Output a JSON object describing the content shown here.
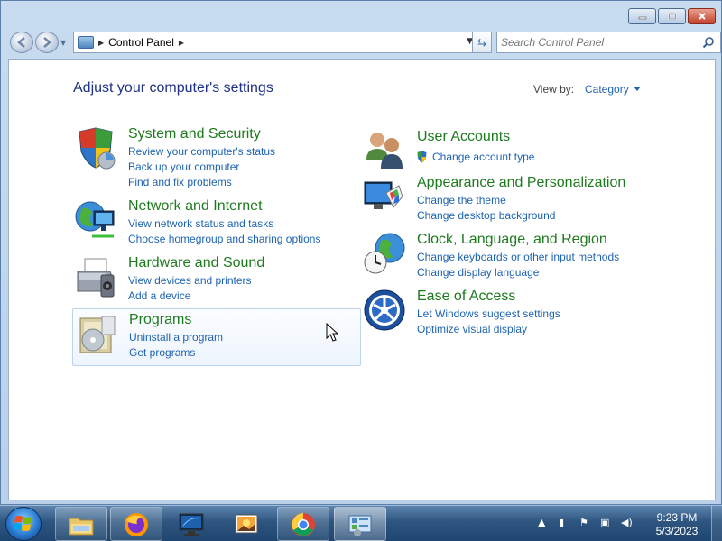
{
  "window": {
    "address_segment": "Control Panel",
    "search_placeholder": "Search Control Panel"
  },
  "page": {
    "heading": "Adjust your computer's settings",
    "view_by_label": "View by:",
    "view_by_value": "Category"
  },
  "categories_left": [
    {
      "title": "System and Security",
      "links": [
        "Review your computer's status",
        "Back up your computer",
        "Find and fix problems"
      ],
      "icon": "shield-icon"
    },
    {
      "title": "Network and Internet",
      "links": [
        "View network status and tasks",
        "Choose homegroup and sharing options"
      ],
      "icon": "network-globe-icon"
    },
    {
      "title": "Hardware and Sound",
      "links": [
        "View devices and printers",
        "Add a device"
      ],
      "icon": "printer-icon"
    },
    {
      "title": "Programs",
      "links": [
        "Uninstall a program",
        "Get programs"
      ],
      "icon": "programs-icon"
    }
  ],
  "categories_right": [
    {
      "title": "User Accounts",
      "links": [
        "Change account type"
      ],
      "icon": "users-icon"
    },
    {
      "title": "Appearance and Personalization",
      "links": [
        "Change the theme",
        "Change desktop background"
      ],
      "icon": "display-palette-icon"
    },
    {
      "title": "Clock, Language, and Region",
      "links": [
        "Change keyboards or other input methods",
        "Change display language"
      ],
      "icon": "clock-globe-icon"
    },
    {
      "title": "Ease of Access",
      "links": [
        "Let Windows suggest settings",
        "Optimize visual display"
      ],
      "icon": "ease-of-access-icon"
    }
  ],
  "taskbar": {
    "items": [
      "file-explorer-icon",
      "firefox-icon",
      "monitor-icon",
      "photo-viewer-icon",
      "chrome-icon",
      "control-panel-icon"
    ],
    "time": "9:23 PM",
    "date": "5/3/2023"
  }
}
